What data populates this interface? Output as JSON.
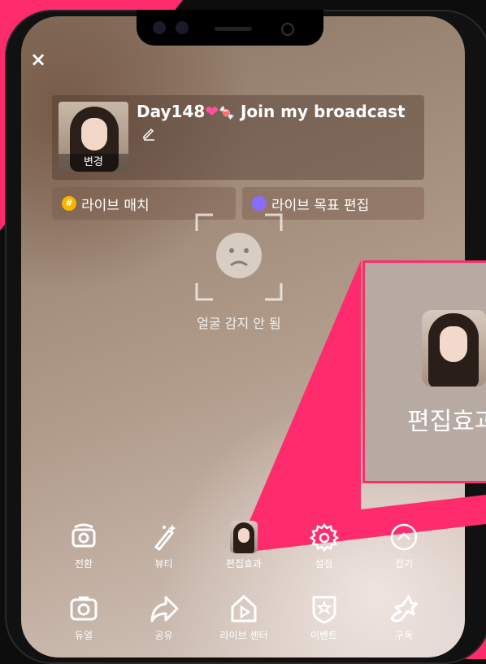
{
  "header": {
    "close_symbol": "×",
    "title": "Day148",
    "title_tail": "Join my broadcast",
    "cover_change_label": "변경"
  },
  "chips": {
    "match_label": "라이브 매치",
    "goal_label": "라이브 목표 편집"
  },
  "face_detection": {
    "status": "얼굴 감지 안 됨"
  },
  "callout": {
    "label": "편집효과"
  },
  "toolbar": {
    "row1": [
      {
        "label": "전환",
        "icon": "camera-flip-icon"
      },
      {
        "label": "뷰티",
        "icon": "magic-wand-icon"
      },
      {
        "label": "편집효과",
        "icon": "effect-thumbnail"
      },
      {
        "label": "설정",
        "icon": "gear-icon"
      },
      {
        "label": "접기",
        "icon": "collapse-up-icon"
      }
    ],
    "row2": [
      {
        "label": "듀얼",
        "icon": "dual-camera-icon"
      },
      {
        "label": "공유",
        "icon": "share-arrow-icon"
      },
      {
        "label": "라이브 센터",
        "icon": "live-center-icon"
      },
      {
        "label": "이벤트",
        "icon": "event-badge-icon"
      },
      {
        "label": "구독",
        "icon": "subscribe-star-icon"
      }
    ]
  },
  "colors": {
    "accent_pink": "#fe2c6c",
    "match_chip_icon": "#f7b500",
    "goal_chip_icon": "#8c6cff"
  }
}
